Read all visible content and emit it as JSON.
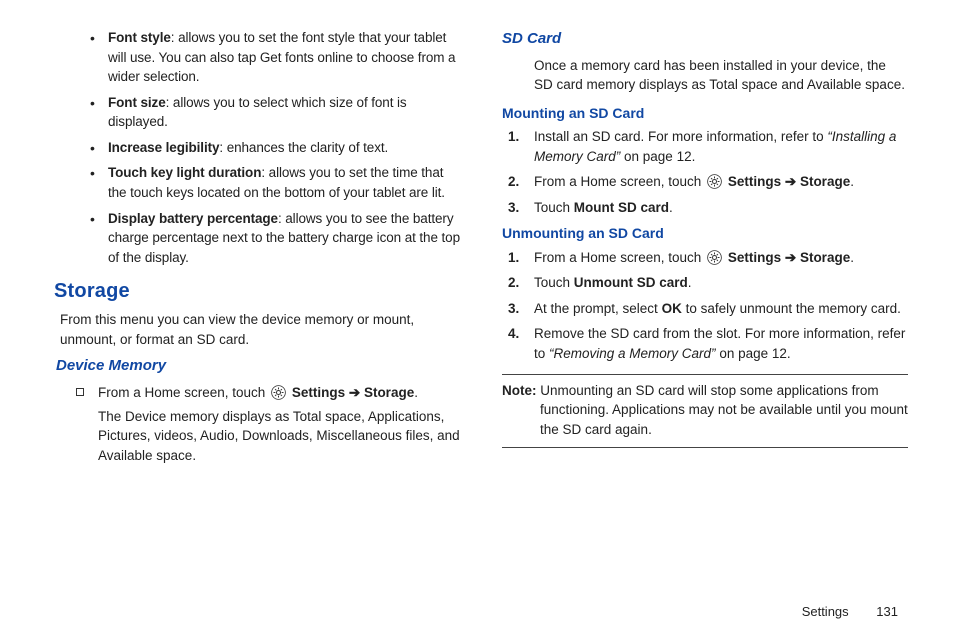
{
  "left": {
    "bullets": [
      {
        "label": "Font style",
        "text": ": allows you to set the font style that your tablet will use. You can also tap Get fonts online to choose from a wider selection."
      },
      {
        "label": "Font size",
        "text": ": allows you to select which size of font is displayed."
      },
      {
        "label": "Increase legibility",
        "text": ": enhances the clarity of text."
      },
      {
        "label": "Touch key light duration",
        "text": ": allows you to set the time that the touch keys located on the bottom of your tablet are lit."
      },
      {
        "label": "Display battery percentage",
        "text": ": allows you to see the battery charge percentage next to the battery charge icon at the top of the display."
      }
    ],
    "storage_heading": "Storage",
    "storage_intro": "From this menu you can view the device memory or mount, unmount, or format an SD card.",
    "device_memory_heading": "Device Memory",
    "dm_line1_pre": "From a Home screen, touch ",
    "dm_line1_settings": "Settings",
    "dm_line1_arrow": " ➔ ",
    "dm_line1_storage": "Storage",
    "dm_line1_end": ".",
    "dm_line2": "The Device memory displays as Total space, Applications, Pictures, videos, Audio, Downloads, Miscellaneous files, and Available space."
  },
  "right": {
    "sd_heading": "SD Card",
    "sd_intro": "Once a memory card has been installed in your device, the SD card memory displays as Total space and Available space.",
    "mount_heading": "Mounting an SD Card",
    "mount_steps": {
      "s1_pre": "Install an SD card. For more information, refer to ",
      "s1_ref": "“Installing a Memory Card”",
      "s1_post": " on page 12.",
      "s2_pre": "From a Home screen, touch ",
      "s2_settings": "Settings",
      "s2_arrow": " ➔ ",
      "s2_storage": "Storage",
      "s2_end": ".",
      "s3_pre": "Touch ",
      "s3_b": "Mount SD card",
      "s3_end": "."
    },
    "unmount_heading": "Unmounting an SD Card",
    "unmount_steps": {
      "s1_pre": "From a Home screen, touch ",
      "s1_settings": "Settings",
      "s1_arrow": " ➔ ",
      "s1_storage": "Storage",
      "s1_end": ".",
      "s2_pre": "Touch ",
      "s2_b": "Unmount SD card",
      "s2_end": ".",
      "s3_pre": "At the prompt, select ",
      "s3_b": "OK",
      "s3_post": " to safely unmount the memory card.",
      "s4_pre": "Remove the SD card from the slot. For more information, refer to ",
      "s4_ref": "“Removing a Memory Card”",
      "s4_post": " on page 12."
    },
    "note_label": "Note:",
    "note_text": " Unmounting an SD card will stop some applications from functioning. Applications may not be available until you mount the SD card again."
  },
  "footer": {
    "section": "Settings",
    "page": "131"
  }
}
